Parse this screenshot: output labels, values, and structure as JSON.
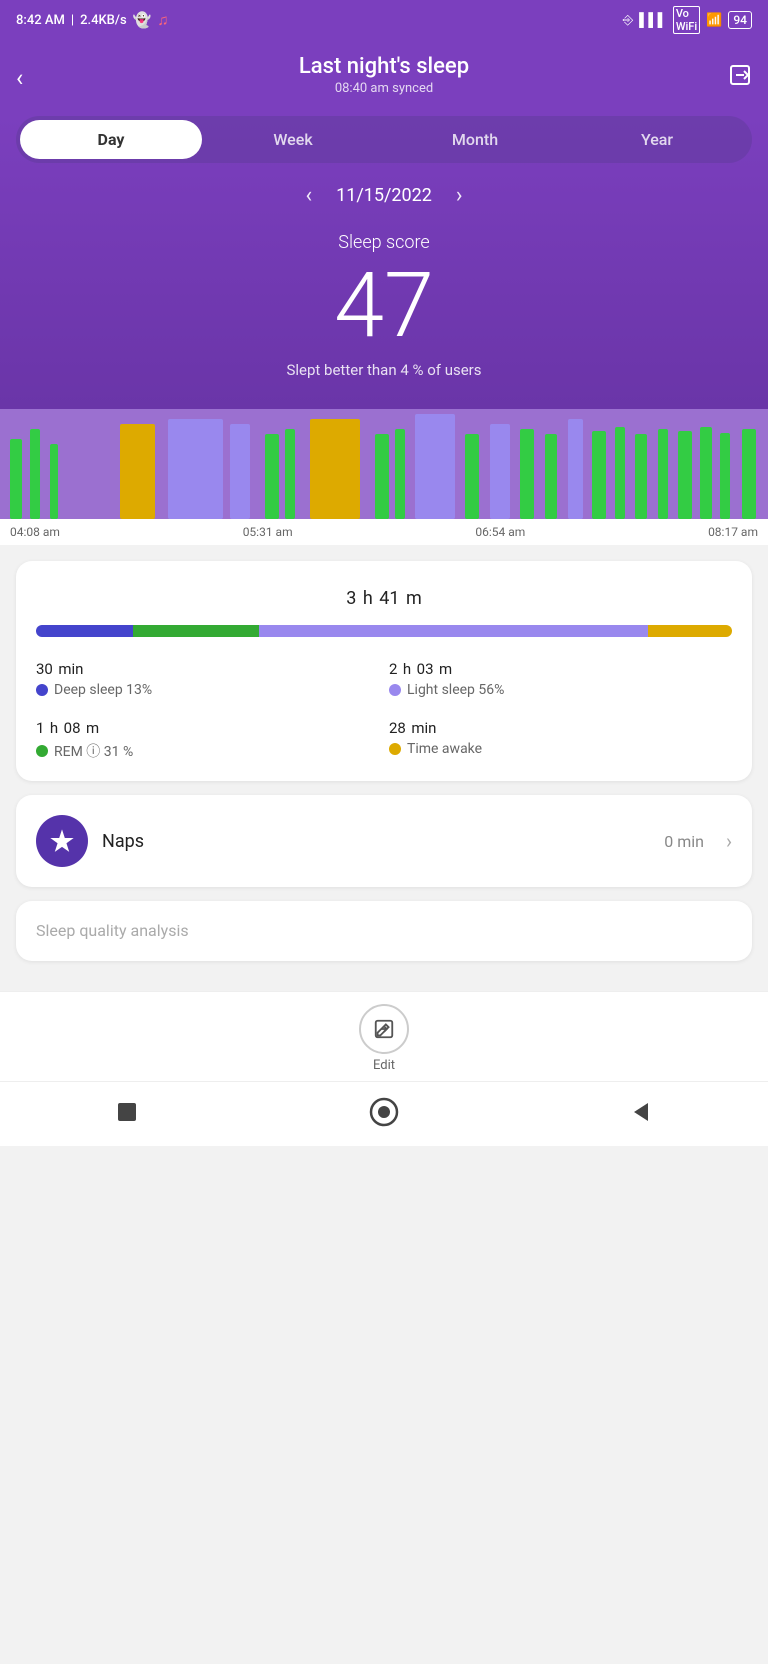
{
  "statusBar": {
    "time": "8:42 AM",
    "network": "2.4KB/s",
    "battery": "94"
  },
  "header": {
    "title": "Last night's sleep",
    "subtitle": "08:40 am synced",
    "backLabel": "‹",
    "exportLabel": "⬡"
  },
  "tabs": [
    {
      "id": "day",
      "label": "Day",
      "active": true
    },
    {
      "id": "week",
      "label": "Week",
      "active": false
    },
    {
      "id": "month",
      "label": "Month",
      "active": false
    },
    {
      "id": "year",
      "label": "Year",
      "active": false
    }
  ],
  "dateNav": {
    "date": "11/15/2022",
    "prevLabel": "‹",
    "nextLabel": "›"
  },
  "sleepScore": {
    "label": "Sleep score",
    "value": "47",
    "description": "Slept better than 4 % of users"
  },
  "timelineLabels": [
    "04:08 am",
    "05:31 am",
    "06:54 am",
    "08:17 am"
  ],
  "duration": {
    "hours": "3",
    "hoursUnit": "h",
    "minutes": "41",
    "minutesUnit": "m"
  },
  "sleepBar": {
    "deep": 14,
    "rem": 18,
    "light": 56,
    "awake": 12
  },
  "sleepStats": [
    {
      "value": "30",
      "valueUnit": "min",
      "labelDot": "deep",
      "label": "Deep sleep 13%"
    },
    {
      "value": "2",
      "valueUnit": "h",
      "valueExtra": "03",
      "valueExtraUnit": "m",
      "labelDot": "light",
      "label": "Light sleep 56%"
    },
    {
      "value": "1",
      "valueUnit": "h",
      "valueExtra": "08",
      "valueExtraUnit": "m",
      "labelDot": "rem",
      "label": "REM ⓘ 31 %"
    },
    {
      "value": "28",
      "valueUnit": "min",
      "labelDot": "awake",
      "label": "Time awake"
    }
  ],
  "naps": {
    "label": "Naps",
    "value": "0 min"
  },
  "qualityAnalysis": {
    "label": "Sleep quality analysis"
  },
  "editBar": {
    "label": "Edit"
  }
}
